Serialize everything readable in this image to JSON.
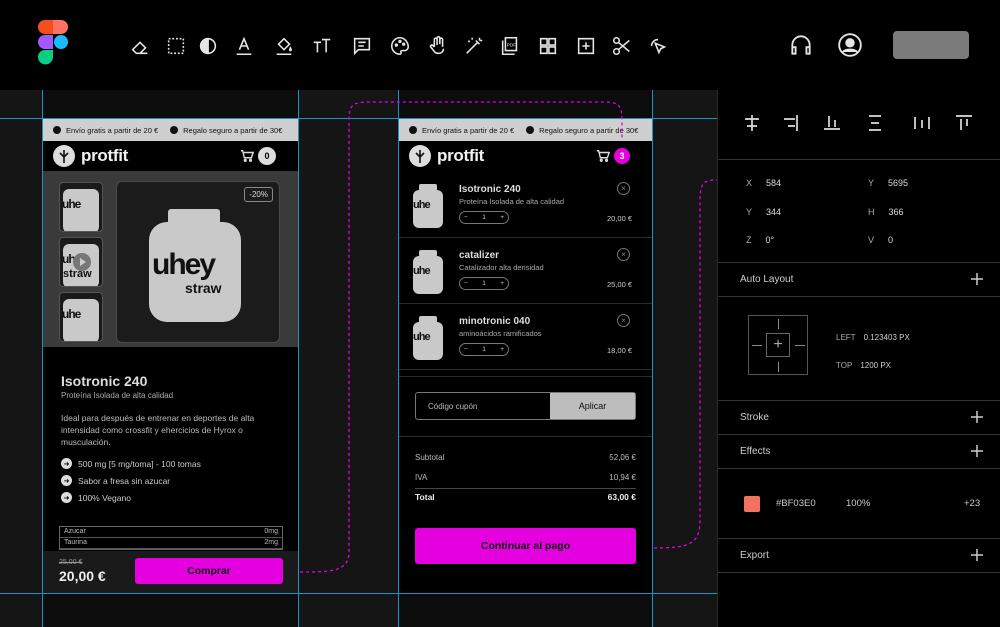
{
  "colors": {
    "accent": "#e500e0",
    "guide": "#1e90c8",
    "swatch": "#F0735E"
  },
  "toolbar": {
    "icons": [
      "eraser-icon",
      "frame-icon",
      "contrast-icon",
      "text-color-icon",
      "fill-icon",
      "text-size-icon",
      "comment-icon",
      "palette-icon",
      "hand-icon",
      "magic-wand-icon",
      "pdf-icon",
      "grid-icon",
      "add-box-icon",
      "scissors-icon",
      "select-pointer-icon"
    ],
    "right_icons": [
      "headphones-icon",
      "user-icon"
    ]
  },
  "product_page": {
    "promo": [
      "Envío gratis a partir de 20 €",
      "Regalo seguro a partir de 30€"
    ],
    "brand": "protfit",
    "cart_count": "0",
    "discount": "-20%",
    "jar_text_1": "uhey",
    "jar_text_2": "straw",
    "thumb_texts": [
      "uhe",
      "uhe",
      "uhe"
    ],
    "thumb_sub": "straw",
    "title": "Isotronic 240",
    "subtitle": "Proteína Isolada de alta calidad",
    "description": "Ideal para después de entrenar en deportes de alta intensidad como crossfit y ehercicios de Hyrox o musculación.",
    "features": [
      "500 mg [5 mg/toma] - 100 tomas",
      "Sabor a fresa sin azucar",
      "100% Vegano"
    ],
    "nutrition": [
      {
        "label": "Azucar",
        "value": "0mg"
      },
      {
        "label": "Taurina",
        "value": "2mg"
      }
    ],
    "old_price": "25,00 €",
    "price": "20,00 €",
    "buy_label": "Comprar"
  },
  "cart_page": {
    "promo": [
      "Envío gratis a partir de 20 €",
      "Regalo seguro a partir de 30€"
    ],
    "brand": "protfit",
    "cart_count": "3",
    "jar_text": "uhe",
    "items": [
      {
        "name": "Isotronic 240",
        "sub": "Proteína Isolada de alta calidad",
        "qty": "1",
        "price": "20,00 €"
      },
      {
        "name": "catalizer",
        "sub": "Catalizador alta densidad",
        "qty": "1",
        "price": "25,00 €"
      },
      {
        "name": "minotronic 040",
        "sub": "aminoácidos ramificados",
        "qty": "1",
        "price": "18,00 €"
      }
    ],
    "qty_minus": "−",
    "qty_plus": "+",
    "remove_glyph": "×",
    "coupon_placeholder": "Código cupón",
    "coupon_button": "Aplicar",
    "totals": [
      {
        "label": "Subtotal",
        "value": "52,06 €"
      },
      {
        "label": "IVA",
        "value": "10,94 €"
      },
      {
        "label": "Total",
        "value": "63,00 €"
      }
    ],
    "continue_label": "Continuar al pago"
  },
  "panel": {
    "props": [
      {
        "k": "X",
        "v": "584"
      },
      {
        "k": "Y",
        "v": "5695"
      },
      {
        "k": "Y",
        "v": "344"
      },
      {
        "k": "H",
        "v": "366"
      },
      {
        "k": "Z",
        "v": "0°"
      },
      {
        "k": "V",
        "v": "0"
      }
    ],
    "auto_layout_title": "Auto Layout",
    "al_left_label": "LEFT",
    "al_left_value": "0.123403 PX",
    "al_top_label": "TOP",
    "al_top_value": "1200 PX",
    "stroke_title": "Stroke",
    "effects_title": "Effects",
    "fill_hex": "#BF03E0",
    "fill_opacity": "100%",
    "fill_extra": "+23",
    "export_title": "Export"
  }
}
